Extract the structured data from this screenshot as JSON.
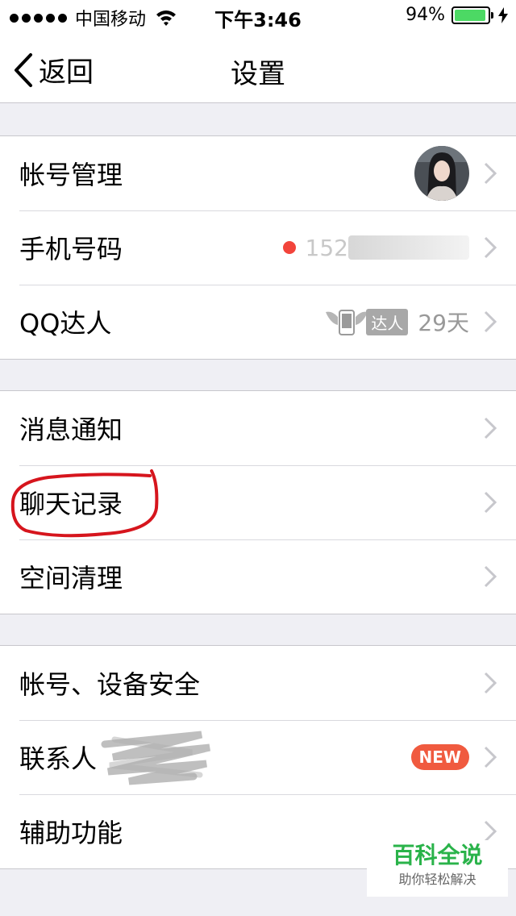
{
  "status_bar": {
    "carrier": "中国移动",
    "time": "下午3:46",
    "battery_pct_text": "94%",
    "battery_level": 0.94,
    "battery_color": "#4cd964"
  },
  "nav": {
    "back_label": "返回",
    "title": "设置"
  },
  "groups": [
    {
      "items": [
        {
          "label": "帐号管理",
          "detail_type": "avatar"
        },
        {
          "label": "手机号码",
          "detail_type": "phone",
          "visible_text": "152"
        },
        {
          "label": "QQ达人",
          "detail_type": "qq-talent",
          "badge": "达人",
          "days": "29天"
        }
      ]
    },
    {
      "items": [
        {
          "label": "消息通知"
        },
        {
          "label": "聊天记录",
          "highlighted": true
        },
        {
          "label": "空间清理"
        }
      ]
    },
    {
      "items": [
        {
          "label": "帐号、设备安全"
        },
        {
          "label": "联系人",
          "badge": "NEW"
        },
        {
          "label": "辅助功能"
        }
      ]
    }
  ],
  "icons": {
    "back": "chevron-left-icon",
    "row": "chevron-right-icon",
    "wifi": "wifi-icon",
    "battery": "battery-icon",
    "charging": "bolt-icon"
  },
  "colors": {
    "accent_red": "#f2443b",
    "new_badge": "#f05a3f",
    "highlight_circle": "#d6151d",
    "watermark_green": "#2ab34a"
  },
  "watermark": {
    "title": "百科全说",
    "subtitle": "助你轻松解决"
  }
}
